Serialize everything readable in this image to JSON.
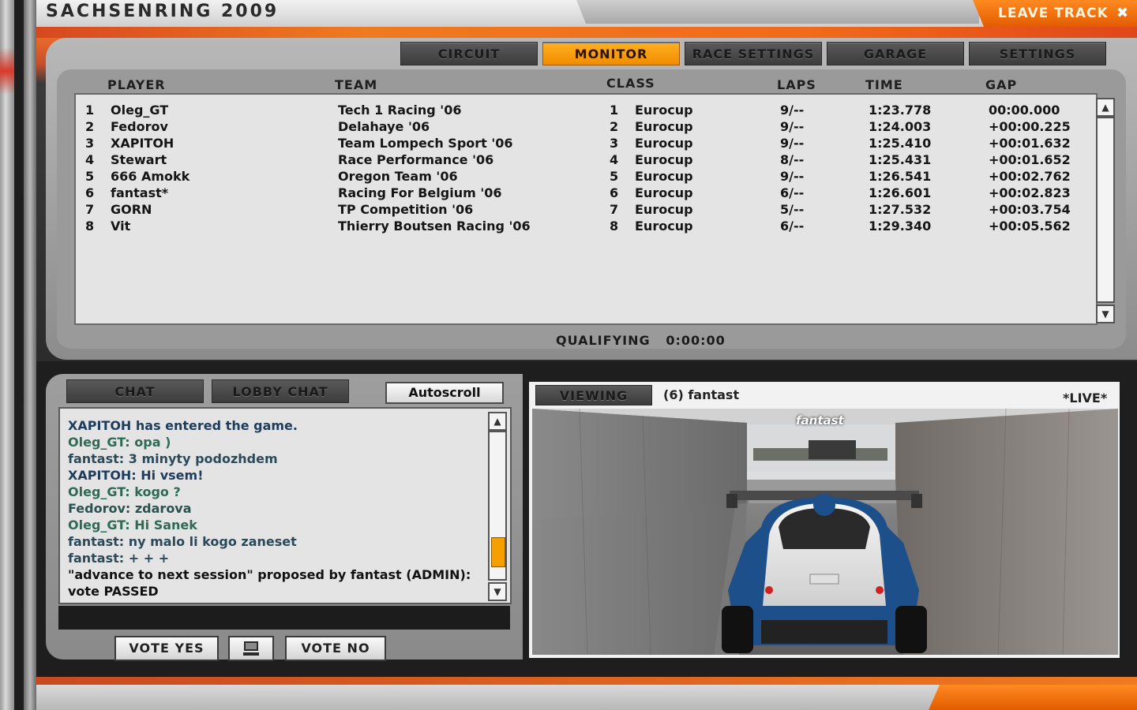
{
  "window": {
    "title": "SACHSENRING 2009",
    "leave_label": "LEAVE TRACK"
  },
  "tabs": [
    {
      "label": "CIRCUIT"
    },
    {
      "label": "MONITOR"
    },
    {
      "label": "RACE SETTINGS"
    },
    {
      "label": "GARAGE"
    },
    {
      "label": "SETTINGS"
    }
  ],
  "standings": {
    "columns": {
      "player": "PLAYER",
      "team": "TEAM",
      "class": "CLASS",
      "laps": "LAPS",
      "time": "TIME",
      "gap": "GAP"
    },
    "rows": [
      {
        "pos": "1",
        "player": "Oleg_GT",
        "team": "Tech 1 Racing '06",
        "class_pos": "1",
        "class": "Eurocup",
        "laps": "9/--",
        "time": "1:23.778",
        "gap": "00:00.000"
      },
      {
        "pos": "2",
        "player": "Fedorov",
        "team": "Delahaye '06",
        "class_pos": "2",
        "class": "Eurocup",
        "laps": "9/--",
        "time": "1:24.003",
        "gap": "+00:00.225"
      },
      {
        "pos": "3",
        "player": "XAPITOH",
        "team": "Team Lompech Sport '06",
        "class_pos": "3",
        "class": "Eurocup",
        "laps": "9/--",
        "time": "1:25.410",
        "gap": "+00:01.632"
      },
      {
        "pos": "4",
        "player": "Stewart",
        "team": "Race Performance '06",
        "class_pos": "4",
        "class": "Eurocup",
        "laps": "8/--",
        "time": "1:25.431",
        "gap": "+00:01.652"
      },
      {
        "pos": "5",
        "player": "666 Amokk",
        "team": "Oregon Team '06",
        "class_pos": "5",
        "class": "Eurocup",
        "laps": "9/--",
        "time": "1:26.541",
        "gap": "+00:02.762"
      },
      {
        "pos": "6",
        "player": "fantast*",
        "team": "Racing For Belgium '06",
        "class_pos": "6",
        "class": "Eurocup",
        "laps": "6/--",
        "time": "1:26.601",
        "gap": "+00:02.823"
      },
      {
        "pos": "7",
        "player": "GORN",
        "team": "TP Competition '06",
        "class_pos": "7",
        "class": "Eurocup",
        "laps": "5/--",
        "time": "1:27.532",
        "gap": "+00:03.754"
      },
      {
        "pos": "8",
        "player": "Vit",
        "team": "Thierry Boutsen Racing '06",
        "class_pos": "8",
        "class": "Eurocup",
        "laps": "6/--",
        "time": "1:29.340",
        "gap": "+00:05.562"
      }
    ]
  },
  "session": {
    "label": "QUALIFYING",
    "timer": "0:00:00"
  },
  "chat": {
    "tab_chat": "CHAT",
    "tab_lobby": "LOBBY CHAT",
    "autoscroll_label": "Autoscroll",
    "scroll_position": 0.9,
    "messages": [
      {
        "text": "XAPITOH has entered the game.",
        "color": "#1e3d5c"
      },
      {
        "text": "Oleg_GT: opa )",
        "color": "#2f6a55"
      },
      {
        "text": "fantast: 3 minyty podozhdem",
        "color": "#2a4a5a"
      },
      {
        "text": "XAPITOH: Hi vsem!",
        "color": "#1e3d5c"
      },
      {
        "text": "Oleg_GT: kogo ?",
        "color": "#2f6a55"
      },
      {
        "text": "Fedorov: zdarova",
        "color": "#2a5050"
      },
      {
        "text": "Oleg_GT: Hi Sanek",
        "color": "#2f6a55"
      },
      {
        "text": "fantast: ny malo li kogo zaneset",
        "color": "#2a4a5a"
      },
      {
        "text": "fantast:  + + +",
        "color": "#2a4a5a"
      },
      {
        "text": "\"advance to next session\" proposed by fantast (ADMIN):",
        "color": "#111111"
      },
      {
        "text": "vote PASSED",
        "color": "#111111"
      }
    ],
    "vote_yes": "VOTE YES",
    "vote_no": "VOTE NO"
  },
  "viewer": {
    "tab_label": "VIEWING",
    "target": "(6) fantast",
    "live": "*LIVE*",
    "driver_tag": "fantast"
  },
  "colors": {
    "accent": "#f08c00",
    "scroll_thumb": "#f5a000"
  }
}
